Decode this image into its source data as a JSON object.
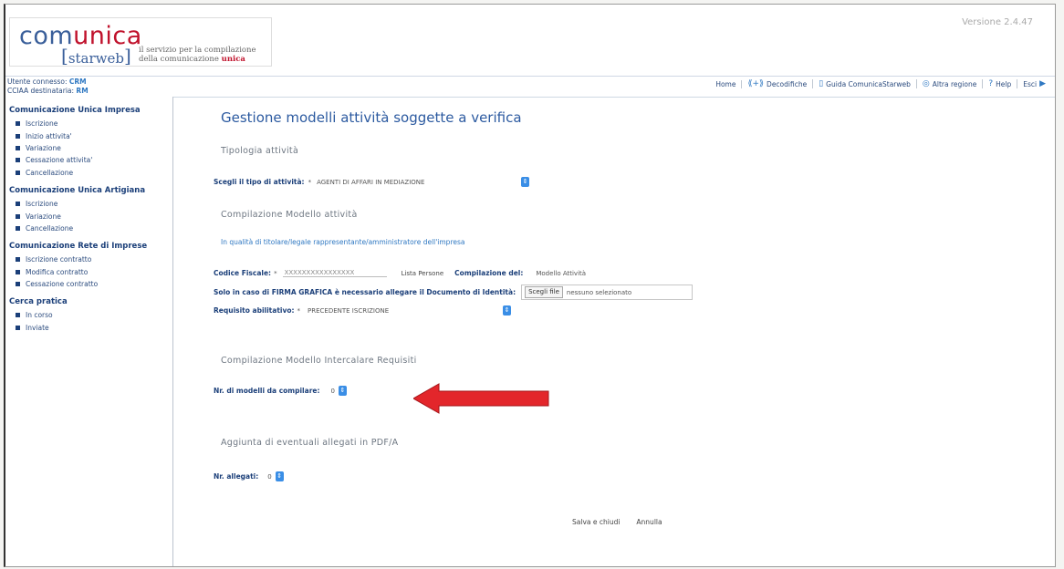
{
  "header": {
    "logo_prefix": "com",
    "logo_highlight": "unica",
    "logo_sub": "starweb",
    "tagline_line1": "il servizio per la compilazione",
    "tagline_line2_prefix": "della comunicazione",
    "tagline_line2_highlight": "unica",
    "version": "Versione 2.4.47"
  },
  "user": {
    "connected_label": "Utente connesso:",
    "connected_value": "CRM",
    "cciaa_label": "CCIAA destinataria:",
    "cciaa_value": "RM"
  },
  "topnav": {
    "home": "Home",
    "decodifiche": "Decodifiche",
    "guida": "Guida ComunicaStarweb",
    "altra_regione": "Altra regione",
    "help": "Help",
    "esci": "Esci"
  },
  "sidebar": {
    "sections": [
      {
        "title": "Comunicazione Unica Impresa",
        "items": [
          "Iscrizione",
          "Inizio attivita'",
          "Variazione",
          "Cessazione attivita'",
          "Cancellazione"
        ]
      },
      {
        "title": "Comunicazione Unica Artigiana",
        "items": [
          "Iscrizione",
          "Variazione",
          "Cancellazione"
        ]
      },
      {
        "title": "Comunicazione Rete di Imprese",
        "items": [
          "Iscrizione contratto",
          "Modifica contratto",
          "Cessazione contratto"
        ]
      },
      {
        "title": "Cerca pratica",
        "items": [
          "In corso",
          "Inviate"
        ]
      }
    ]
  },
  "main": {
    "title": "Gestione modelli attività soggette a verifica",
    "tipologia": {
      "heading": "Tipologia attività",
      "label": "Scegli il tipo di attività:",
      "required": "*",
      "value": "AGENTI DI AFFARI IN MEDIAZIONE"
    },
    "compilazione": {
      "heading": "Compilazione Modello attività",
      "link": "In qualità di titolare/legale rappresentante/amministratore dell'impresa",
      "cf_label": "Codice Fiscale:",
      "cf_required": "*",
      "cf_value": "XXXXXXXXXXXXXXXX",
      "lista_persone": "Lista Persone",
      "compilazione_del_label": "Compilazione del:",
      "compilazione_del_value": "Modello Attività",
      "firma_label": "Solo in caso di FIRMA GRAFICA è necessario allegare il Documento di Identità:",
      "file_button": "Scegli file",
      "file_status": "nessuno selezionato",
      "requisito_label": "Requisito abilitativo:",
      "requisito_required": "*",
      "requisito_value": "PRECEDENTE ISCRIZIONE"
    },
    "intercalare": {
      "heading": "Compilazione Modello Intercalare Requisiti",
      "label": "Nr. di modelli da compilare:",
      "value": "0"
    },
    "allegati": {
      "heading": "Aggiunta di eventuali allegati in PDF/A",
      "label": "Nr. allegati:",
      "value": "0"
    },
    "actions": {
      "save": "Salva e chiudi",
      "cancel": "Annulla"
    }
  },
  "colors": {
    "brand_blue": "#2c5aa0",
    "brand_red": "#c0122c",
    "select_blue": "#3a8ee6",
    "arrow_red": "#e3262b"
  }
}
